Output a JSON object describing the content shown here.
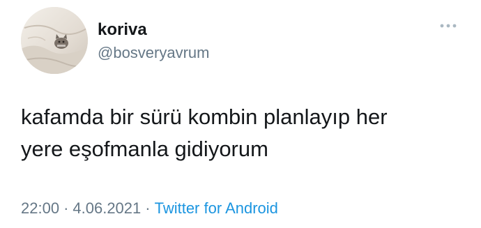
{
  "user": {
    "display_name": "koriva",
    "handle": "@bosveryavrum"
  },
  "tweet": {
    "line1": "kafamda bir sürü kombin planlayıp her",
    "line2": "yere eşofmanla gidiyorum"
  },
  "meta": {
    "time": "22:00",
    "separator": "·",
    "date": "4.06.2021",
    "source": "Twitter for Android"
  },
  "icons": {
    "more": "more-horizontal-icon",
    "avatar": "cat-on-blanket-avatar"
  },
  "colors": {
    "text": "#14171a",
    "secondary": "#657786",
    "link": "#1b95e0"
  }
}
